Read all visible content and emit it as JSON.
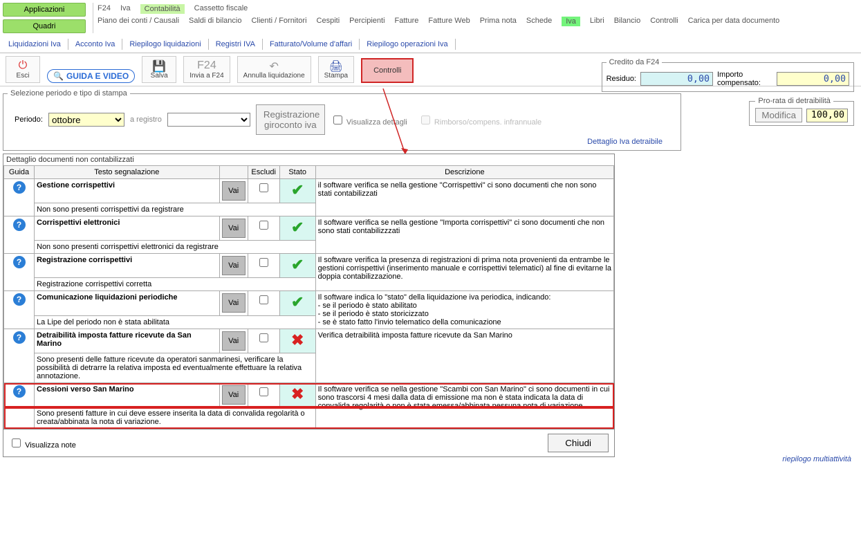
{
  "nav": {
    "applicazioni": "Applicazioni",
    "quadri": "Quadri",
    "main_tabs": [
      "F24",
      "Iva",
      "Contabilità",
      "Cassetto fiscale"
    ],
    "sub_tabs": [
      "Piano dei conti / Causali",
      "Saldi di bilancio",
      "Clienti / Fornitori",
      "Cespiti",
      "Percipienti",
      "Fatture",
      "Fatture Web",
      "Prima nota",
      "Schede",
      "Iva",
      "Libri",
      "Bilancio",
      "Controlli",
      "Carica per data documento"
    ],
    "section_tabs": [
      "Liquidazioni Iva",
      "Acconto Iva",
      "Riepilogo liquidazioni",
      "Registri IVA",
      "Fatturato/Volume d'affari",
      "Riepilogo operazioni Iva"
    ]
  },
  "toolbar": {
    "esci": "Esci",
    "guida_video": "GUIDA E VIDEO",
    "salva": "Salva",
    "invia": "Invia a F24",
    "annulla": "Annulla liquidazione",
    "stampa": "Stampa",
    "controlli": "Controlli"
  },
  "period": {
    "fieldset": "Selezione periodo e tipo di stampa",
    "periodo_label": "Periodo:",
    "periodo_value": "ottobre",
    "a_registro": "a registro",
    "reg_giroconto": "Registrazione giroconto iva",
    "visualizza_dettagli": "Visualizza dettagli",
    "rimborso": "Rimborso/compens. infrannuale",
    "dettaglio_link": "Dettaglio Iva detraibile"
  },
  "credito": {
    "legend": "Credito da F24",
    "residuo_label": "Residuo:",
    "residuo_value": "0,00",
    "importo_label": "Importo compensato:",
    "importo_value": "0,00"
  },
  "prorata": {
    "legend": "Pro-rata di detraibilità",
    "modifica": "Modifica",
    "value": "100,00"
  },
  "detail": {
    "title": "Dettaglio documenti non contabilizzati",
    "headers": {
      "guida": "Guida",
      "testo": "Testo segnalazione",
      "escludi": "Escludi",
      "stato": "Stato",
      "descrizione": "Descrizione"
    },
    "vai": "Vai",
    "rows": [
      {
        "title": "Gestione corrispettivi",
        "note": "Non sono presenti corrispettivi da registrare",
        "status": "ok",
        "desc": "il software verifica se nella gestione \"Corrispettivi\" ci sono documenti che non sono stati contabilizzati"
      },
      {
        "title": "Corrispettivi elettronici",
        "note": "Non sono presenti corrispettivi elettronici da registrare",
        "status": "ok",
        "desc": "Il software verifica se nella gestione \"Importa corrispettivi\" ci sono documenti che non sono stati contabilizzzati"
      },
      {
        "title": "Registrazione corrispettivi",
        "note": "Registrazione corrispettivi corretta",
        "status": "ok",
        "desc": "Il software verifica la presenza di registrazioni di prima nota provenienti da entrambe le gestioni corrispettivi (inserimento manuale e corrispettivi telematici) al fine di evitarne la doppia contabilizzazione."
      },
      {
        "title": "Comunicazione liquidazioni periodiche",
        "note": "La Lipe del periodo non è stata abilitata",
        "status": "ok",
        "desc": "Il software indica lo \"stato\" della liquidazione iva periodica, indicando:\n- se il periodo è stato abilitato\n- se il periodo è stato storicizzato\n- se è stato fatto l'invio telematico della comunicazione"
      },
      {
        "title": "Detraibilità imposta fatture ricevute da San Marino",
        "note": "Sono presenti delle fatture ricevute da operatori sanmarinesi, verificare la possibilità di detrarre la relativa imposta ed eventualmente effettuare la relativa annotazione.",
        "status": "fail",
        "desc": "Verifica detraibilità imposta fatture ricevute da San Marino"
      },
      {
        "title": "Cessioni verso San Marino",
        "note": "Sono presenti fatture in cui deve essere inserita la data di convalida regolarità o creata/abbinata la nota di variazione.",
        "status": "fail",
        "highlight": true,
        "desc": "Il software verifica se nella gestione \"Scambi con San Marino\" ci sono documenti in cui sono trascorsi 4 mesi dalla data di emissione ma non è stata indicata la data di convalida regolarità o non è stata emessa/abbinata nessuna nota di variazione"
      }
    ]
  },
  "footer": {
    "visualizza_note": "Visualizza note",
    "chiudi": "Chiudi",
    "riepilogo": "riepilogo multiattività"
  }
}
